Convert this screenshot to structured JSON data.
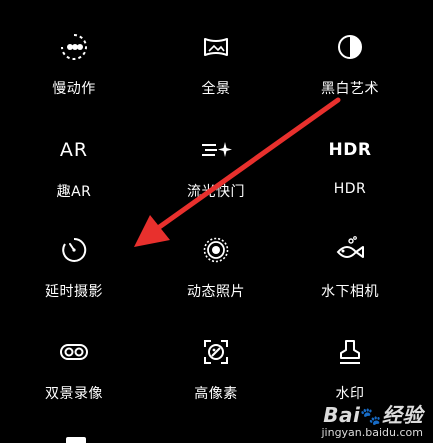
{
  "modes": [
    {
      "id": "slow-motion",
      "label": "慢动作",
      "icon": "slow-motion-icon"
    },
    {
      "id": "panorama",
      "label": "全景",
      "icon": "panorama-icon"
    },
    {
      "id": "mono-art",
      "label": "黑白艺术",
      "icon": "black-white-icon"
    },
    {
      "id": "fun-ar",
      "label": "趣AR",
      "icon": "ar-icon",
      "icon_text": "AR"
    },
    {
      "id": "light-painting",
      "label": "流光快门",
      "icon": "light-painting-icon"
    },
    {
      "id": "hdr",
      "label": "HDR",
      "icon": "hdr-icon",
      "icon_text": "HDR"
    },
    {
      "id": "time-lapse",
      "label": "延时摄影",
      "icon": "timer-icon"
    },
    {
      "id": "moving-picture",
      "label": "动态照片",
      "icon": "moving-picture-icon"
    },
    {
      "id": "underwater",
      "label": "水下相机",
      "icon": "fish-icon"
    },
    {
      "id": "dual-view",
      "label": "双景录像",
      "icon": "dual-view-icon"
    },
    {
      "id": "hi-res",
      "label": "高像素",
      "icon": "high-res-icon"
    },
    {
      "id": "watermark",
      "label": "水印",
      "icon": "stamp-icon"
    }
  ],
  "overlay": {
    "arrow_color": "#e8302d",
    "watermark_brand": "Bai",
    "watermark_brand_suffix": "经验",
    "watermark_url": "jingyan.baidu.com"
  }
}
